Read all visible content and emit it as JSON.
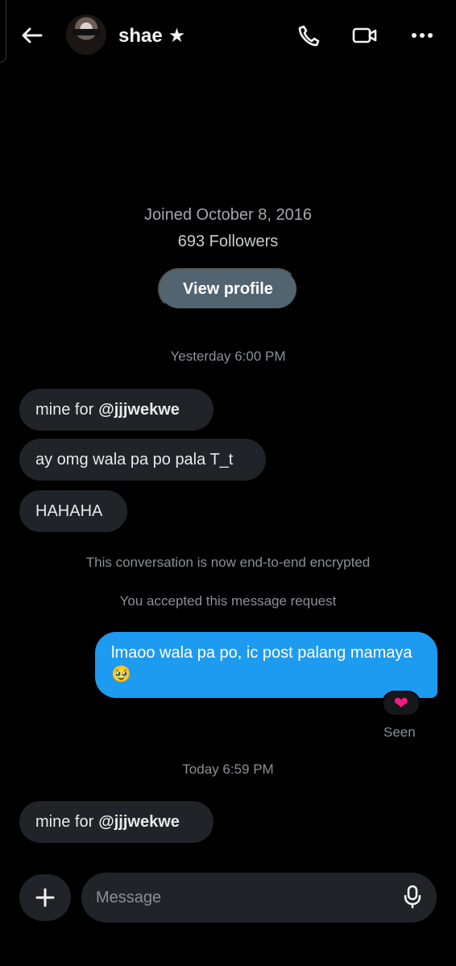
{
  "header": {
    "name": "shae",
    "badge": "★",
    "icons": [
      "back-arrow-icon",
      "avatar",
      "phone-icon",
      "video-icon",
      "more-icon"
    ]
  },
  "profile": {
    "joined": "Joined October 8, 2016",
    "followers": "693 Followers",
    "view_profile_label": "View profile"
  },
  "conversation": {
    "timestamp_1": "Yesterday 6:00 PM",
    "incoming_1_prefix": "mine for",
    "incoming_1_handle": "@jjjwekwe",
    "incoming_2": "ay omg wala pa po pala T_t",
    "incoming_3": "HAHAHA",
    "encrypted_notice": "This conversation is now end-to-end encrypted",
    "request_notice": "You accepted this message request",
    "outgoing_1": "lmaoo wala pa po, ic post palang mamaya 🥹",
    "reaction": "❤",
    "seen_label": "Seen",
    "timestamp_2": "Today 6:59 PM",
    "incoming_4_prefix": "mine for",
    "incoming_4_handle": "@jjjwekwe"
  },
  "composer": {
    "placeholder": "Message"
  },
  "colors": {
    "background": "#000000",
    "incoming_bubble": "#202327",
    "outgoing_bubble": "#1d9bf0",
    "button": "#536471",
    "reaction": "#f91880"
  }
}
